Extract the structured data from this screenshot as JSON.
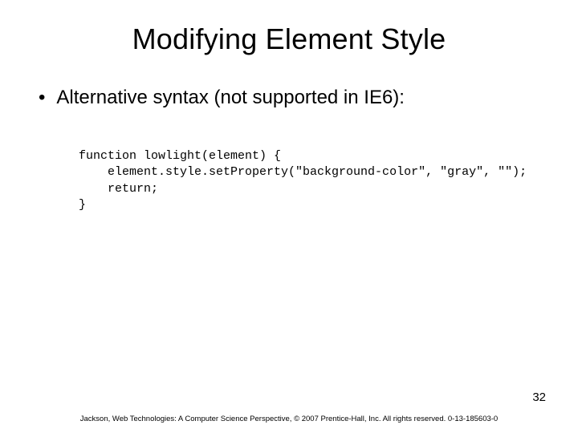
{
  "title": "Modifying Element Style",
  "bullet": {
    "marker": "•",
    "text": "Alternative syntax (not supported in IE6):"
  },
  "code": "function lowlight(element) {\n    element.style.setProperty(\"background-color\", \"gray\", \"\");\n    return;\n}",
  "page_number": "32",
  "footer": "Jackson, Web Technologies: A Computer Science Perspective, © 2007 Prentice-Hall, Inc. All rights reserved. 0-13-185603-0"
}
